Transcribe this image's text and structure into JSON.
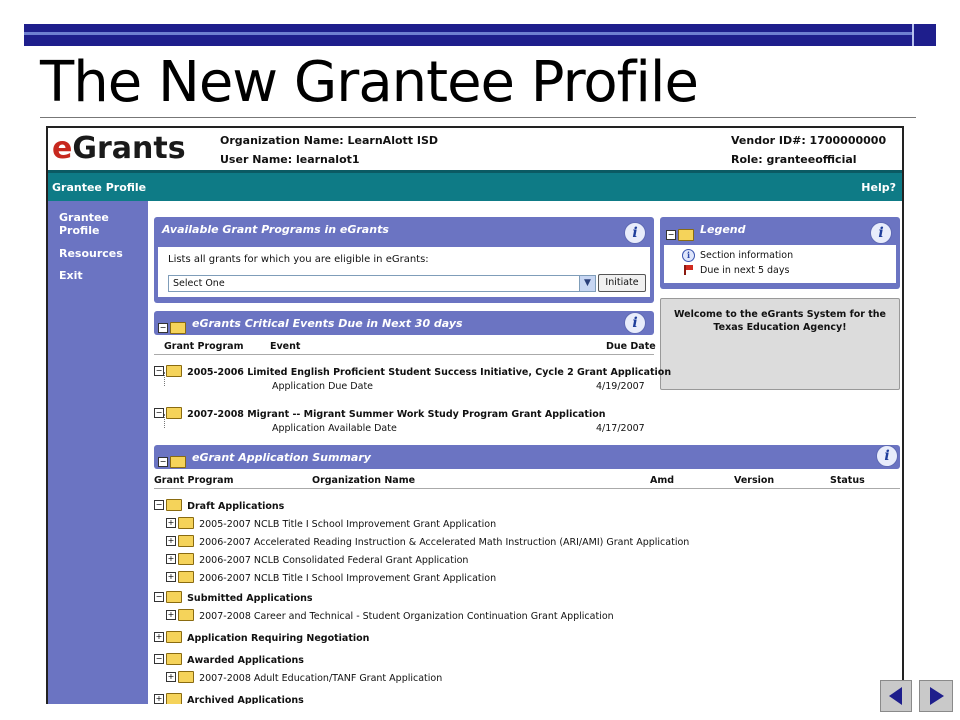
{
  "slide": {
    "title": "The New Grantee Profile"
  },
  "header": {
    "logo_e": "e",
    "logo_rest": "Grants",
    "org_label": "Organization Name: LearnAlott ISD",
    "user_label": "User Name: learnalot1",
    "vendor_label": "Vendor ID#: 1700000000",
    "role_label": "Role: granteeofficial"
  },
  "navbar": {
    "left": "Grantee Profile",
    "right": "Help?"
  },
  "sidebar": {
    "items": [
      {
        "label": "Grantee Profile"
      },
      {
        "label": "Resources"
      },
      {
        "label": "Exit"
      }
    ]
  },
  "available": {
    "title": "Available Grant Programs in eGrants",
    "instructions": "Lists all grants for which you are eligible in eGrants:",
    "select_value": "Select One",
    "button": "Initiate"
  },
  "legend": {
    "title": "Legend",
    "items": [
      {
        "label": "Section information"
      },
      {
        "label": "Due in next 5 days"
      }
    ]
  },
  "welcome": {
    "text": "Welcome to the eGrants System for the Texas Education Agency!"
  },
  "critical": {
    "title": "eGrants Critical Events Due in Next 30 days",
    "columns": [
      "Grant Program",
      "Event",
      "Due Date"
    ],
    "groups": [
      {
        "name": "2005-2006 Limited English Proficient Student Success Initiative, Cycle 2 Grant Application",
        "event": "Application Due Date",
        "date": "4/19/2007"
      },
      {
        "name": "2007-2008 Migrant -- Migrant Summer Work Study Program Grant Application",
        "event": "Application Available Date",
        "date": "4/17/2007"
      }
    ]
  },
  "summary": {
    "title": "eGrant Application Summary",
    "columns": [
      "Grant Program",
      "Organization Name",
      "Amd",
      "Version",
      "Status"
    ],
    "draft_label": "Draft Applications",
    "draft_items": [
      "2005-2007 NCLB Title I School Improvement Grant Application",
      "2006-2007 Accelerated Reading Instruction & Accelerated Math Instruction (ARI/AMI) Grant Application",
      "2006-2007 NCLB Consolidated Federal Grant Application",
      "2006-2007 NCLB Title I School Improvement Grant Application"
    ],
    "submitted_label": "Submitted Applications",
    "submitted_items": [
      "2007-2008 Career and Technical - Student Organization Continuation Grant Application"
    ],
    "negotiation_label": "Application Requiring Negotiation",
    "awarded_label": "Awarded Applications",
    "awarded_items": [
      "2007-2008 Adult Education/TANF Grant Application"
    ],
    "archived_label": "Archived Applications"
  },
  "icons": {
    "info": "i",
    "expand": "+",
    "collapse": "−"
  },
  "colors": {
    "panel": "#6b74c2",
    "navbar": "#0e7b86",
    "slide_bar": "#1e1e8c"
  }
}
